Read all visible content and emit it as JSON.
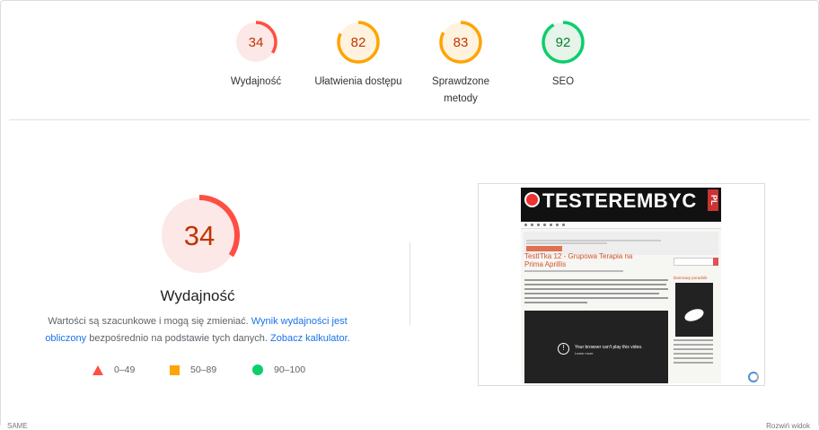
{
  "scores": [
    {
      "value": "34",
      "label": "Wydajność",
      "fraction": 0.34,
      "color": "#c33300",
      "track": "#fce8e6",
      "ring": "#ff4e42"
    },
    {
      "value": "82",
      "label": "Ułatwienia dostępu",
      "fraction": 0.82,
      "color": "#c33300",
      "track": "#fff3e0",
      "ring": "#ffa400"
    },
    {
      "value": "83",
      "label": "Sprawdzone metody",
      "fraction": 0.83,
      "color": "#c33300",
      "track": "#fff3e0",
      "ring": "#ffa400"
    },
    {
      "value": "92",
      "label": "SEO",
      "fraction": 0.92,
      "color": "#08802b",
      "track": "#e6f4ea",
      "ring": "#0cce6b"
    }
  ],
  "main": {
    "score": "34",
    "fraction": 0.34,
    "title": "Wydajność",
    "desc_prefix": "Wartości są szacunkowe i mogą się zmieniać. ",
    "link1": "Wynik wydajności jest obliczony",
    "desc_middle": " bezpośrednio na podstawie tych danych. ",
    "link2": "Zobacz kalkulator.",
    "desc_suffix": ""
  },
  "legend": [
    {
      "shape": "triangle",
      "range": "0–49",
      "color": "#ff4e42"
    },
    {
      "shape": "square",
      "range": "50–89",
      "color": "#ffa400"
    },
    {
      "shape": "circle",
      "range": "90–100",
      "color": "#0cce6b"
    }
  ],
  "screenshot": {
    "logo_text": "TESTEREMBYC",
    "logo_suffix": "PL",
    "post_title": "TestITka 12 - Grupowa Terapia na Prima Aprillis",
    "video_text": "Your browser can't play this video.",
    "video_link": "Learn more",
    "sidebar_title": "Darmowy poradnik"
  },
  "bottom": {
    "left": "SAME",
    "right": "Rozwiń widok"
  }
}
